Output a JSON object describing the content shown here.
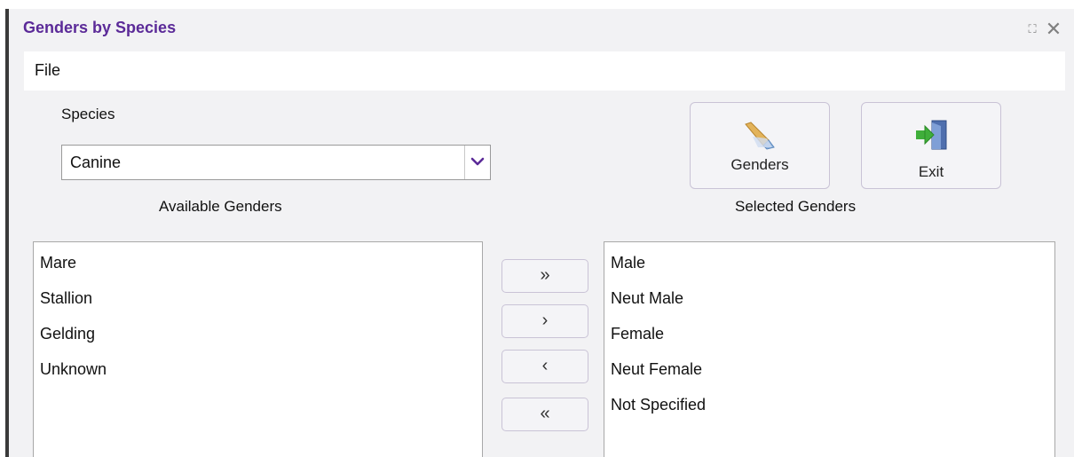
{
  "window": {
    "title": "Genders by Species",
    "maximize_glyph": "⛶",
    "close_glyph": "✕"
  },
  "menu": {
    "file": "File"
  },
  "species": {
    "label": "Species",
    "selected": "Canine"
  },
  "toolbar": {
    "genders_label": "Genders",
    "genders_icon": "pencil-icon",
    "exit_label": "Exit",
    "exit_icon": "exit-door-icon"
  },
  "available": {
    "label": "Available Genders",
    "items": [
      "Mare",
      "Stallion",
      "Gelding",
      "Unknown"
    ]
  },
  "selected": {
    "label": "Selected Genders",
    "items": [
      "Male",
      "Neut Male",
      "Female",
      "Neut Female",
      "Not Specified"
    ]
  },
  "move_buttons": {
    "add_all": "»",
    "add_one": "›",
    "remove_one": "‹",
    "remove_all": "«"
  },
  "colors": {
    "title": "#5b2a98",
    "dropdown_chevron": "#5b2a98"
  }
}
